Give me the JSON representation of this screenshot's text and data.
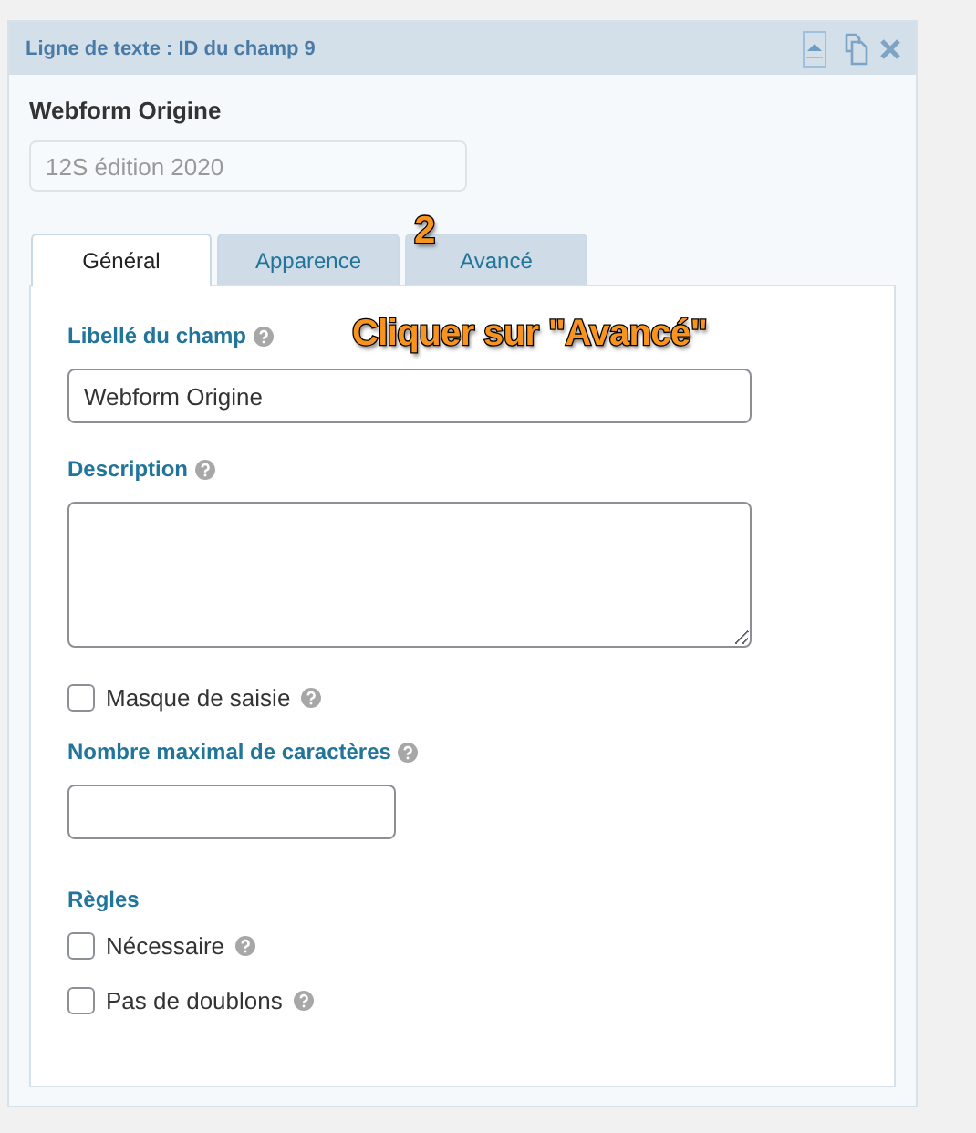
{
  "panel": {
    "title": "Ligne de texte : ID du champ 9"
  },
  "field_name": "Webform Origine",
  "preview_field": {
    "placeholder": "12S édition 2020"
  },
  "tabs": [
    {
      "label": "Général",
      "selected": true
    },
    {
      "label": "Apparence",
      "selected": false
    },
    {
      "label": "Avancé",
      "selected": false
    }
  ],
  "settings": [
    {
      "kind": "text",
      "label": "Libellé du champ",
      "value": "Webform Origine"
    },
    {
      "kind": "textarea",
      "label": "Description"
    },
    {
      "kind": "checkbox",
      "label": "Masque de saisie",
      "checked": false
    },
    {
      "kind": "short",
      "label": "Nombre maximal de caractères"
    },
    {
      "kind": "heading",
      "label": "Règles"
    },
    {
      "kind": "checkbox",
      "label": "Nécessaire",
      "checked": false
    },
    {
      "kind": "checkbox",
      "label": "Pas de doublons",
      "checked": false
    }
  ],
  "annotations": [
    {
      "kind": "step",
      "text": "2"
    },
    {
      "kind": "callout",
      "text": "Cliquer sur \"Avancé\""
    }
  ]
}
